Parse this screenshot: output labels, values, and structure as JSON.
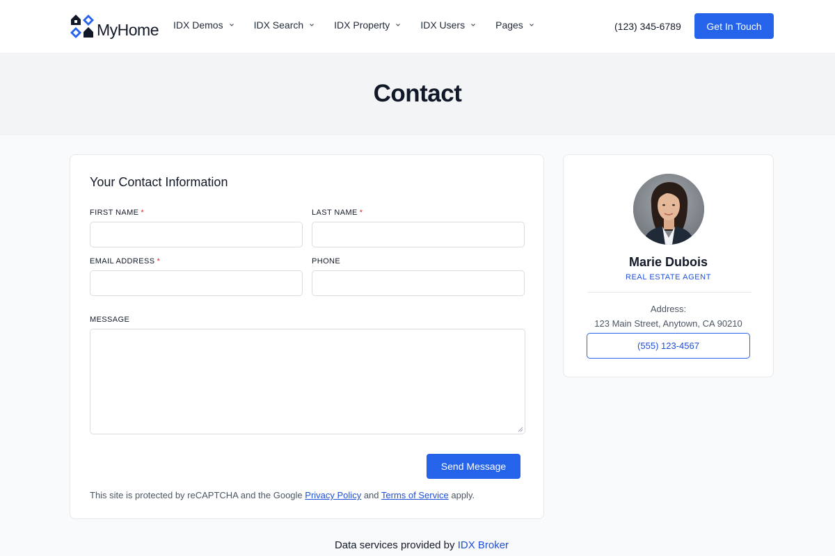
{
  "header": {
    "logo_text": "MyHome",
    "nav": [
      {
        "label": "IDX Demos"
      },
      {
        "label": "IDX Search"
      },
      {
        "label": "IDX Property"
      },
      {
        "label": "IDX Users"
      },
      {
        "label": "Pages"
      }
    ],
    "phone": "(123) 345-6789",
    "cta_label": "Get In Touch"
  },
  "hero": {
    "title": "Contact"
  },
  "form": {
    "title": "Your Contact Information",
    "required_marker": "*",
    "fields": {
      "first_name": {
        "label": "FIRST NAME",
        "value": ""
      },
      "last_name": {
        "label": "LAST NAME",
        "value": ""
      },
      "email": {
        "label": "EMAIL ADDRESS",
        "value": ""
      },
      "phone": {
        "label": "PHONE",
        "value": ""
      },
      "message": {
        "label": "MESSAGE",
        "value": ""
      }
    },
    "submit_label": "Send Message",
    "captcha": {
      "prefix": "This site is protected by reCAPTCHA and the Google",
      "privacy_link": "Privacy Policy",
      "and": "and",
      "terms_link": "Terms of Service",
      "suffix": "apply."
    }
  },
  "agent": {
    "name": "Marie Dubois",
    "role": "REAL ESTATE AGENT",
    "address_label": "Address:",
    "address": "123 Main Street, Anytown, CA 90210",
    "phone": "(555) 123-4567"
  },
  "footer": {
    "prefix": "Data services provided by",
    "link": "IDX Broker"
  },
  "colors": {
    "accent": "#2563eb",
    "required": "#dc2626",
    "link": "#1d4ed8"
  }
}
